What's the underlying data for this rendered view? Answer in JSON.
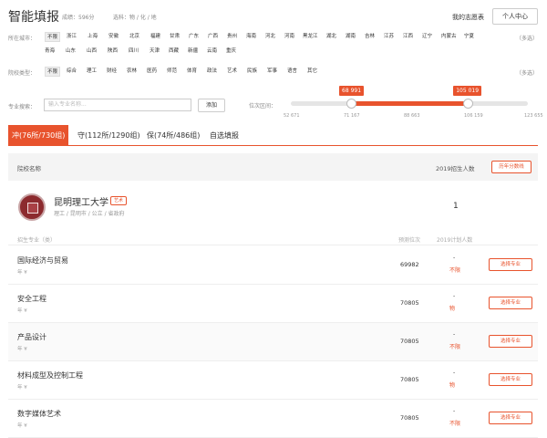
{
  "header": {
    "title": "智能填报",
    "score": "成绩：596分",
    "subjects": "选科：物 / 化 / 地",
    "wishlist": "我的志愿表",
    "user_center": "个人中心"
  },
  "location_filter": {
    "label": "所在城市：",
    "multi": "（多选）",
    "row1": [
      "不限",
      "浙江",
      "上海",
      "安徽",
      "北京",
      "福建",
      "甘肃",
      "广东",
      "广西",
      "贵州",
      "海南",
      "河北",
      "河南",
      "黑龙江",
      "湖北",
      "湖南",
      "吉林",
      "江苏",
      "江西",
      "辽宁",
      "内蒙古",
      "宁夏"
    ],
    "row2": [
      "青海",
      "山东",
      "山西",
      "陕西",
      "四川",
      "天津",
      "西藏",
      "新疆",
      "云南",
      "重庆"
    ]
  },
  "type_filter": {
    "label": "院校类型：",
    "multi": "（多选）",
    "items": [
      "不限",
      "综合",
      "理工",
      "财经",
      "农林",
      "医药",
      "师范",
      "体育",
      "政法",
      "艺术",
      "民族",
      "军事",
      "语言",
      "其它"
    ]
  },
  "search": {
    "label": "专业搜索：",
    "placeholder": "输入专业名称...",
    "add_label": "添加"
  },
  "rank_range": {
    "label": "位次区间：",
    "low_value": "68 991",
    "high_value": "105 019",
    "low_fraction": 0.254,
    "high_fraction": 0.747,
    "ticks": [
      "52 671",
      "71 167",
      "88 663",
      "106 159",
      "123 655"
    ]
  },
  "tabs": [
    {
      "label": "冲(76所/730组)"
    },
    {
      "label": "守(112所/1290组)"
    },
    {
      "label": "保(74所/486组)"
    },
    {
      "label": "自选填报"
    }
  ],
  "table": {
    "col_name": "院校名称",
    "col_year": "2019招生人数",
    "history_button": "历年分数线"
  },
  "college": {
    "name": "昆明理工大学",
    "tag": "艺术",
    "info": "理工  / 昆明市  / 公立  / 省政府",
    "count": "1"
  },
  "major_head": {
    "label": "招生专业（类）",
    "rank": "预测位次",
    "plan": "2019计划人数"
  },
  "majors": [
    {
      "name": "国际经济与贸易",
      "meta": "年   ¥",
      "rank": "69982",
      "dash": "-",
      "plan": "不限",
      "button": "选择专业"
    },
    {
      "name": "安全工程",
      "meta": "年   ¥",
      "rank": "70805",
      "dash": "-",
      "plan": "物",
      "button": "选择专业"
    },
    {
      "name": "产品设计",
      "meta": "年   ¥",
      "rank": "70805",
      "dash": "-",
      "plan": "不限",
      "button": "选择专业"
    },
    {
      "name": "材料成型及控制工程",
      "meta": "年   ¥",
      "rank": "70805",
      "dash": "-",
      "plan": "物",
      "button": "选择专业"
    },
    {
      "name": "数字媒体艺术",
      "meta": "年   ¥",
      "rank": "70805",
      "dash": "-",
      "plan": "不限",
      "button": "选择专业"
    }
  ]
}
